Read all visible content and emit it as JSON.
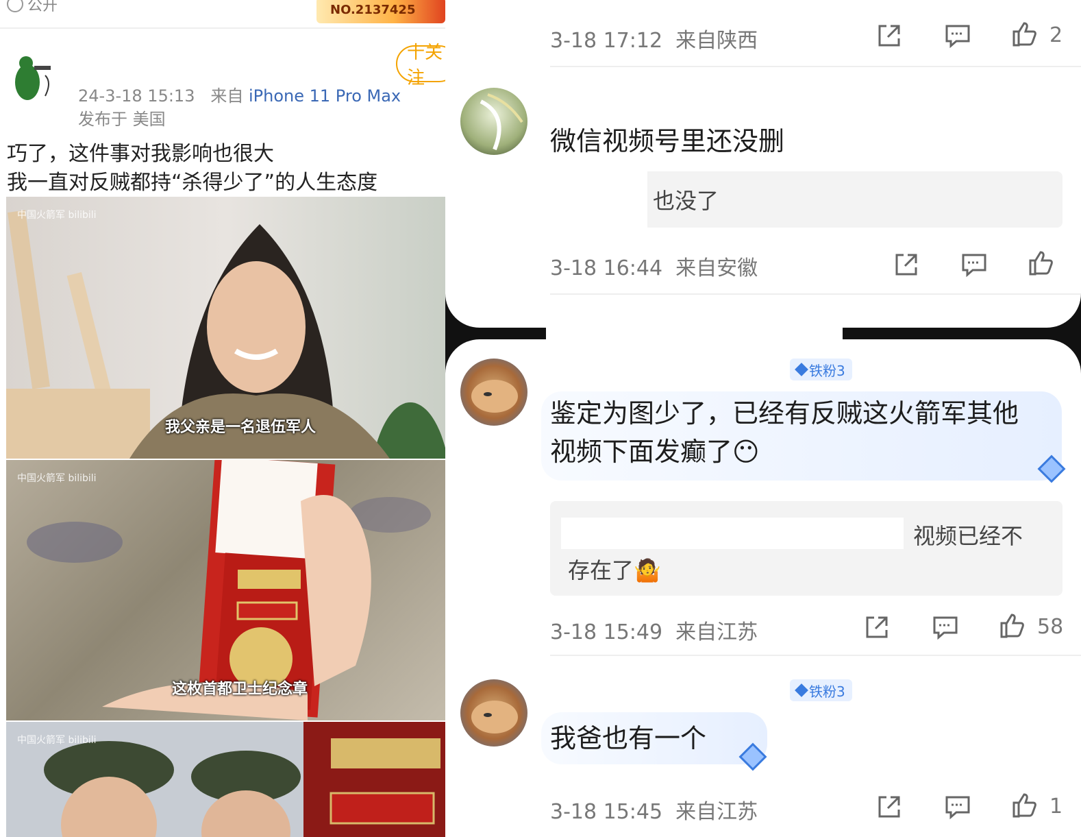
{
  "left_post": {
    "privacy_label": "公开",
    "badge_text": "NO.2137425",
    "follow_label": "十关注",
    "timestamp": "24-3-18 15:13",
    "from_label": "来自",
    "device": "iPhone 11 Pro Max",
    "location": "发布于 美国",
    "text_line1": "巧了，这件事对我影响也很大",
    "text_line2": "我一直对反贼都持“杀得少了”的人生态度",
    "watermark": "中国火箭军 bilibili",
    "subtitle1": "我父亲是一名退伍军人",
    "subtitle2": "这枚首都卫士纪念章"
  },
  "comments_top": [
    {
      "time": "3-18 17:12",
      "region": "来自陕西",
      "likes": "2"
    },
    {
      "text": "微信视频号里还没删",
      "reply": "也没了",
      "time": "3-18 16:44",
      "region": "来自安徽",
      "likes": ""
    }
  ],
  "comments_bottom": [
    {
      "fan_badge": "铁粉3",
      "text_line1": "鉴定为图少了，已经有反贼这火箭军其他",
      "text_line2": "视频下面发癫了😶",
      "reply_line1": "视频已经不",
      "reply_line2": "存在了🤷",
      "time": "3-18 15:49",
      "region": "来自江苏",
      "likes": "58"
    },
    {
      "fan_badge": "铁粉3",
      "text": "我爸也有一个",
      "time": "3-18 15:45",
      "region": "来自江苏",
      "likes": "1"
    }
  ],
  "icons": {
    "share": "share-icon",
    "comment": "comment-icon",
    "like": "thumbs-up-icon"
  },
  "colors": {
    "follow": "#f4a300",
    "device_link": "#3a68b5",
    "fan_badge": "#3a7bdf"
  }
}
